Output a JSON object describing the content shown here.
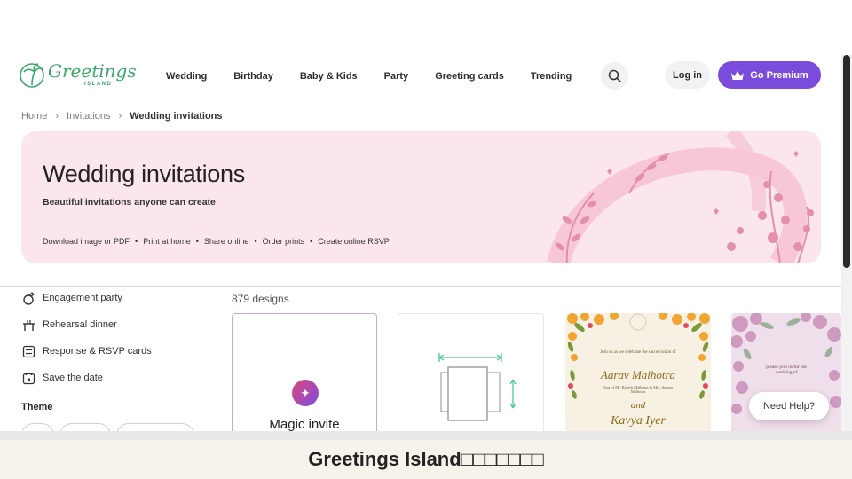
{
  "header": {
    "logo_text": "Greetings",
    "logo_sub": "ISLAND",
    "nav": [
      "Wedding",
      "Birthday",
      "Baby & Kids",
      "Party",
      "Greeting cards",
      "Trending"
    ],
    "login_label": "Log in",
    "premium_label": "Go Premium"
  },
  "breadcrumb": {
    "home": "Home",
    "invitations": "Invitations",
    "current": "Wedding invitations"
  },
  "hero": {
    "title": "Wedding invitations",
    "subtitle": "Beautiful invitations anyone can create",
    "features": [
      "Download image or PDF",
      "Print at home",
      "Share online",
      "Order prints",
      "Create online RSVP"
    ],
    "separator": "•"
  },
  "sidebar": {
    "items": [
      {
        "label": "Engagement party",
        "icon": "ring-icon"
      },
      {
        "label": "Rehearsal dinner",
        "icon": "table-icon"
      },
      {
        "label": "Response & RSVP cards",
        "icon": "rsvp-card-icon"
      },
      {
        "label": "Save the date",
        "icon": "calendar-icon"
      }
    ],
    "theme_label": "Theme"
  },
  "content": {
    "count_label": "879 designs",
    "magic_label": "Magic invite",
    "aarav_card": {
      "intro": "Join us as we celebrate the sacred union of",
      "groom": "Aarav Malhotra",
      "groom_parents": "Son of Mr. Rajesh Malhotra & Mrs. Seema Malhotra",
      "and": "and",
      "bride": "Kavya Iyer"
    },
    "purple_card": {
      "intro": "please join us for the wedding of"
    }
  },
  "help_label": "Need Help?",
  "caption": "Greetings Island□□□□□□□",
  "colors": {
    "accent": "#7b4cdc",
    "hero_bg": "#fbe6ec",
    "logo_green": "#3aa76d"
  }
}
